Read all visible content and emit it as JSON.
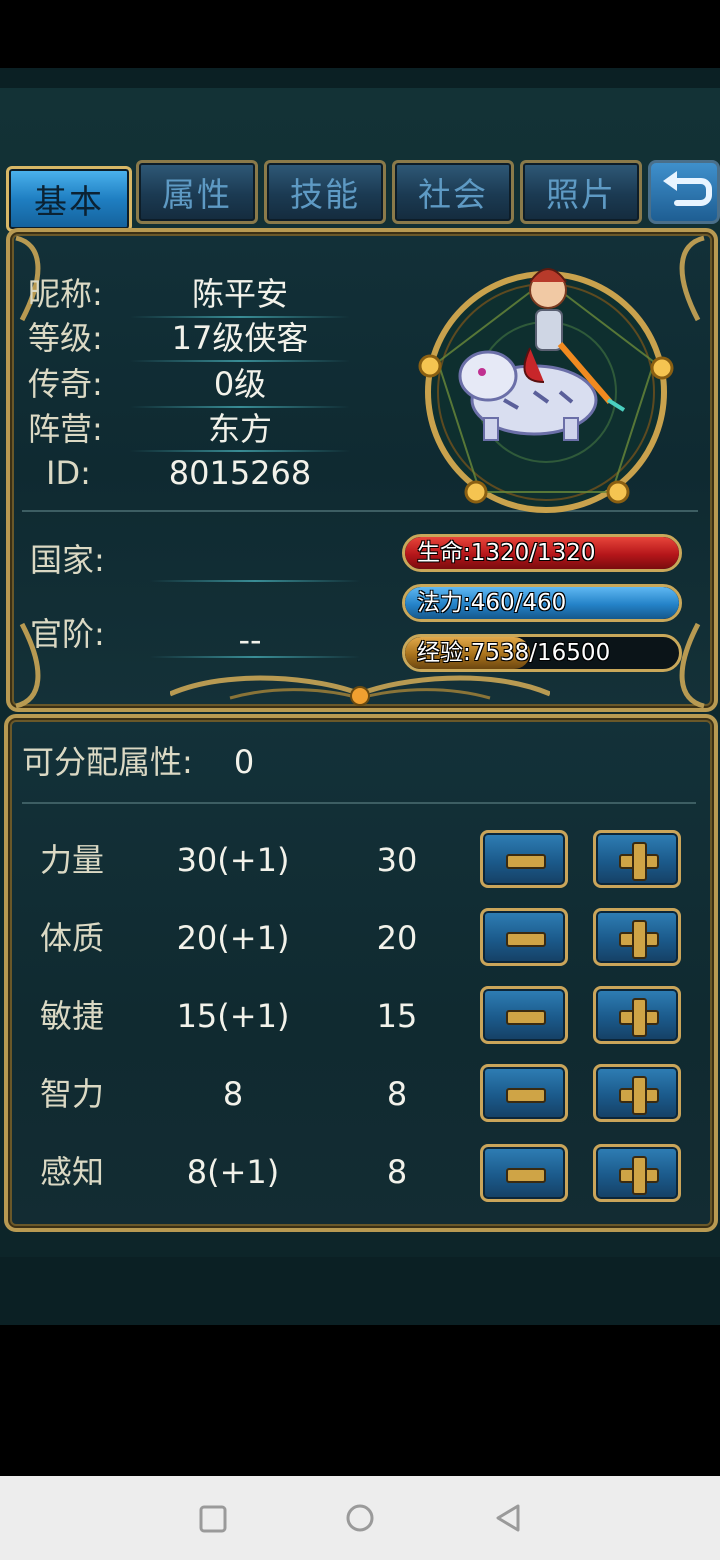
{
  "tabs": [
    {
      "label": "基本"
    },
    {
      "label": "属性"
    },
    {
      "label": "技能"
    },
    {
      "label": "社会"
    },
    {
      "label": "照片"
    }
  ],
  "info": {
    "nickname_label": "昵称:",
    "nickname": "陈平安",
    "level_label": "等级:",
    "level": "17级侠客",
    "legend_label": "传奇:",
    "legend": "0级",
    "camp_label": "阵营:",
    "camp": "东方",
    "id_label": "ID:",
    "id": "8015268",
    "country_label": "国家:",
    "country": "",
    "rank_label": "官阶:",
    "rank": "--"
  },
  "bars": {
    "hp": {
      "text": "生命:1320/1320",
      "current": 1320,
      "max": 1320,
      "color": "#c81a1a"
    },
    "mp": {
      "text": "法力:460/460",
      "current": 460,
      "max": 460,
      "color": "#2a8fd6"
    },
    "exp": {
      "text": "经验:7538/16500",
      "current": 7538,
      "max": 16500,
      "color": "#b07a1a"
    }
  },
  "points": {
    "label": "可分配属性:",
    "value": "0"
  },
  "stats": [
    {
      "name": "力量",
      "base": "30(+1)",
      "current": "30"
    },
    {
      "name": "体质",
      "base": "20(+1)",
      "current": "20"
    },
    {
      "name": "敏捷",
      "base": "15(+1)",
      "current": "15"
    },
    {
      "name": "智力",
      "base": "8",
      "current": "8"
    },
    {
      "name": "感知",
      "base": "8(+1)",
      "current": "8"
    }
  ],
  "icons": {
    "back": "back-arrow-icon",
    "nav_square": "recent-apps-icon",
    "nav_circle": "home-icon",
    "nav_triangle": "back-icon"
  }
}
